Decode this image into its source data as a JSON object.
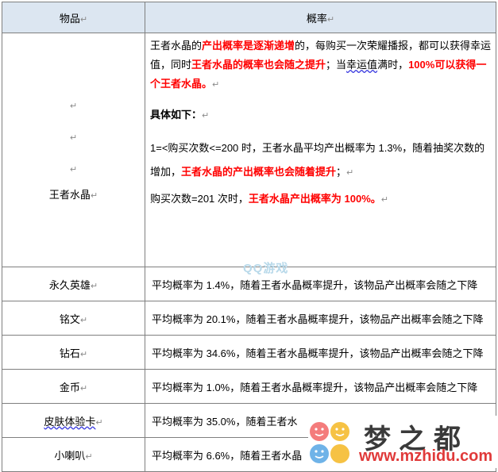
{
  "header": {
    "item": "物品",
    "prob": "概率"
  },
  "crystal": {
    "name": "王者水晶",
    "p1_a": "王者水晶的",
    "p1_b": "产出概率是逐渐递增",
    "p1_c": "的，每购买一次荣耀播报，都可以获得幸",
    "p1_d": "运值，同时",
    "p1_e": "王者水晶的概率也会随之提升",
    "p1_f": "；当",
    "p1_g": "幸运值",
    "p1_h": "满时，",
    "p1_i": "100%可以获得一个王者水晶",
    "p1_j": "。",
    "p2": "具体如下：",
    "p3_a": "1=<购买次数<=200 时，王者水晶平均产出概率为 1.3%，随着抽奖次数的增加，",
    "p3_b": "王者水晶的产出概率也会随着提升",
    "p3_c": "；",
    "p4_a": "购买次数=201 次时，",
    "p4_b": "王者水晶产出概率为 100%。"
  },
  "rows": [
    {
      "item": "永久英雄",
      "desc": "平均概率为 1.4%，随着王者水晶概率提升，该物品产出概率会随之下降"
    },
    {
      "item": "铭文",
      "desc": "平均概率为 20.1%，随着王者水晶概率提升，该物品产出概率会随之下降"
    },
    {
      "item": "钻石",
      "desc": "平均概率为 34.6%，随着王者水晶概率提升，该物品产出概率会随之下降"
    },
    {
      "item": "金币",
      "desc": "平均概率为 1.0%，随着王者水晶概率提升，该物品产出概率会随之下降"
    },
    {
      "item": "皮肤体验卡",
      "desc": "平均概率为 35.0%，随着王者水"
    },
    {
      "item": "小喇叭",
      "desc": "平均概率为 6.6%，随着王者水晶"
    }
  ],
  "watermark": {
    "top_text": "QQ游戏",
    "brand": "梦之都",
    "url": "www.mzhidu.com"
  },
  "colors": {
    "header_bg": "#dce6f1",
    "highlight": "#ff0000",
    "border": "#7f7f7f"
  }
}
